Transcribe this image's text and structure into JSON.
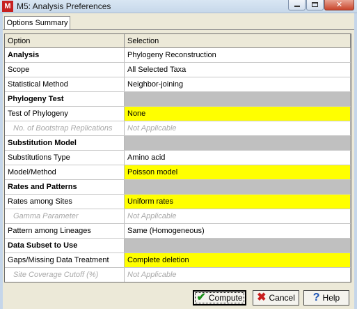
{
  "window": {
    "icon_label": "M",
    "title": "M5: Analysis Preferences",
    "close_glyph": "✕"
  },
  "tab": {
    "label": "Options Summary"
  },
  "table": {
    "headers": {
      "option": "Option",
      "selection": "Selection"
    },
    "rows": [
      {
        "option": "Analysis",
        "selection": "Phylogeny Reconstruction",
        "kind": "section-text"
      },
      {
        "option": "Scope",
        "selection": "All Selected Taxa",
        "kind": "normal"
      },
      {
        "option": "Statistical Method",
        "selection": "Neighbor-joining",
        "kind": "normal"
      },
      {
        "option": "Phylogeny Test",
        "selection": "",
        "kind": "section"
      },
      {
        "option": "Test of Phylogeny",
        "selection": "None",
        "kind": "highlight"
      },
      {
        "option": "No. of Bootstrap Replications",
        "selection": "Not Applicable",
        "kind": "disabled"
      },
      {
        "option": "Substitution Model",
        "selection": "",
        "kind": "section"
      },
      {
        "option": "Substitutions Type",
        "selection": "Amino acid",
        "kind": "normal"
      },
      {
        "option": "Model/Method",
        "selection": "Poisson model",
        "kind": "highlight"
      },
      {
        "option": "Rates and Patterns",
        "selection": "",
        "kind": "section"
      },
      {
        "option": "Rates among Sites",
        "selection": "Uniform rates",
        "kind": "highlight"
      },
      {
        "option": "Gamma Parameter",
        "selection": "Not Applicable",
        "kind": "disabled"
      },
      {
        "option": "Pattern among Lineages",
        "selection": "Same (Homogeneous)",
        "kind": "normal"
      },
      {
        "option": "Data Subset to Use",
        "selection": "",
        "kind": "section"
      },
      {
        "option": "Gaps/Missing Data Treatment",
        "selection": "Complete deletion",
        "kind": "highlight"
      },
      {
        "option": "Site Coverage Cutoff (%)",
        "selection": "Not Applicable",
        "kind": "disabled"
      }
    ]
  },
  "buttons": {
    "compute": "Compute",
    "cancel": "Cancel",
    "help": "Help"
  },
  "icons": {
    "compute": "check-icon",
    "cancel": "x-icon",
    "help": "question-icon"
  },
  "colors": {
    "highlight": "#ffff00",
    "section": "#c0c0c0",
    "disabled_text": "#a8a8a8"
  }
}
